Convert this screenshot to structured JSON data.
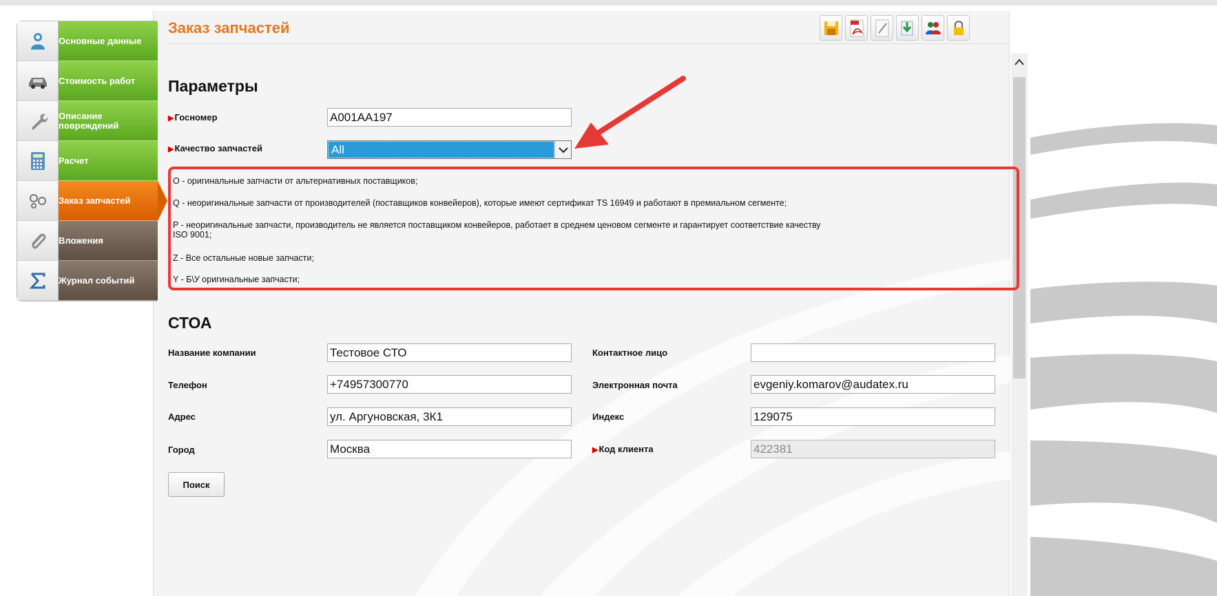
{
  "sidebar": {
    "items": [
      {
        "label": "Основные данные",
        "icon": "person-icon",
        "color": "green"
      },
      {
        "label": "Стоимость работ",
        "icon": "car-icon",
        "color": "green"
      },
      {
        "label": "Описание повреждений",
        "icon": "wrench-icon",
        "color": "green"
      },
      {
        "label": "Расчет",
        "icon": "calculator-icon",
        "color": "green"
      },
      {
        "label": "Заказ запчастей",
        "icon": "parts-icon",
        "color": "orange",
        "active": true
      },
      {
        "label": "Вложения",
        "icon": "paperclip-icon",
        "color": "brown"
      },
      {
        "label": "Журнал событий",
        "icon": "sigma-icon",
        "color": "brown"
      }
    ]
  },
  "page": {
    "title": "Заказ запчастей"
  },
  "toolbar": {
    "buttons": [
      "save-icon",
      "pdf-icon",
      "edit-icon",
      "download-icon",
      "users-icon",
      "lock-icon"
    ]
  },
  "params": {
    "heading": "Параметры",
    "gosnomer_label": "Госномер",
    "gosnomer_value": "A001AA197",
    "quality_label": "Качество запчастей",
    "quality_value": "All"
  },
  "legend": {
    "lines": [
      "O - оригинальные запчасти от альтернативных поставщиков;",
      "Q - неоригинальные запчасти от производителей (поставщиков конвейеров), которые имеют сертификат TS 16949 и работают в премиальном сегменте;",
      "P - неоригинальные запчасти, производитель не является поставщиком конвейеров, работает в среднем ценовом сегменте и гарантирует соответствие качеству",
      "ISO 9001;",
      "Z - Все остальные новые запчасти;",
      "Y - Б\\У оригинальные запчасти;"
    ]
  },
  "stoa": {
    "heading": "СТОА",
    "company_label": "Название компании",
    "company_value": "Тестовое СТО",
    "phone_label": "Телефон",
    "phone_value": "+74957300770",
    "address_label": "Адрес",
    "address_value": "ул. Аргуновская, 3К1",
    "city_label": "Город",
    "city_value": "Москва",
    "contact_label": "Контактное лицо",
    "contact_value": "",
    "email_label": "Электронная почта",
    "email_value": "evgeniy.komarov@audatex.ru",
    "index_label": "Индекс",
    "index_value": "129075",
    "client_code_label": "Код клиента",
    "client_code_value": "422381",
    "search_button": "Поиск"
  },
  "colors": {
    "accent": "#e8771e",
    "nav_green": "#6cbb2e",
    "nav_orange": "#e16a0a",
    "nav_brown": "#6e5e51",
    "highlight": "#e53935",
    "select_blue": "#2a9bd8"
  }
}
